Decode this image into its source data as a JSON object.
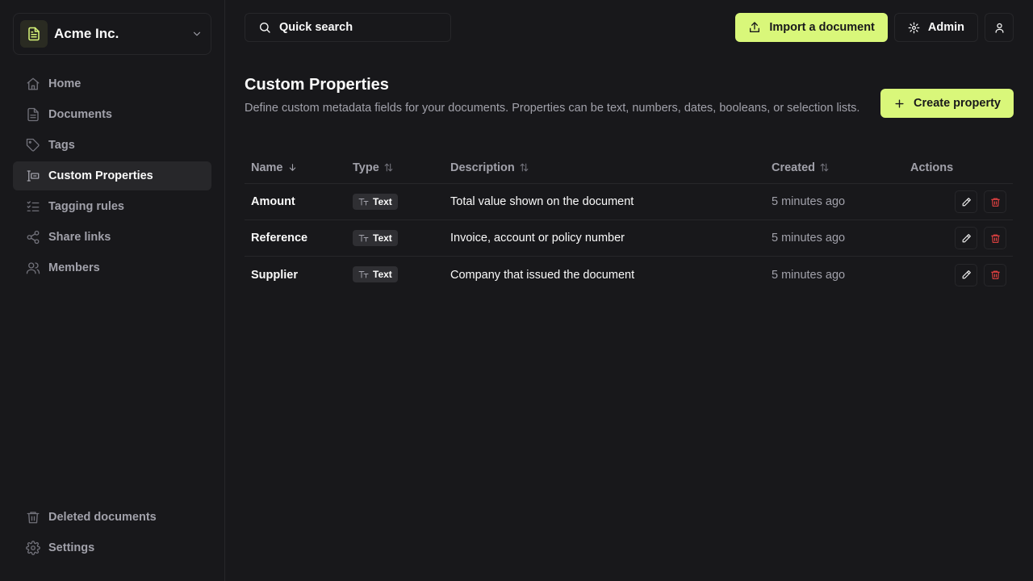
{
  "org": {
    "name": "Acme Inc.",
    "logo_icon": "document-icon",
    "accent": "#d9f77a"
  },
  "nav": {
    "items": [
      {
        "label": "Home",
        "icon": "home-icon"
      },
      {
        "label": "Documents",
        "icon": "file-icon"
      },
      {
        "label": "Tags",
        "icon": "tag-icon"
      },
      {
        "label": "Custom Properties",
        "icon": "properties-icon",
        "active": true
      },
      {
        "label": "Tagging rules",
        "icon": "list-check-icon"
      },
      {
        "label": "Share links",
        "icon": "share-icon"
      },
      {
        "label": "Members",
        "icon": "users-icon"
      }
    ],
    "bottom": [
      {
        "label": "Deleted documents",
        "icon": "trash-icon"
      },
      {
        "label": "Settings",
        "icon": "gear-icon"
      }
    ]
  },
  "topbar": {
    "search_label": "Quick search",
    "import_label": "Import a document",
    "admin_label": "Admin"
  },
  "page": {
    "title": "Custom Properties",
    "description": "Define custom metadata fields for your documents. Properties can be text, numbers, dates, booleans, or selection lists.",
    "create_label": "Create property"
  },
  "table": {
    "headers": {
      "name": "Name",
      "type": "Type",
      "description": "Description",
      "created": "Created",
      "actions": "Actions"
    },
    "rows": [
      {
        "name": "Amount",
        "type": "Text",
        "description": "Total value shown on the document",
        "created": "5 minutes ago"
      },
      {
        "name": "Reference",
        "type": "Text",
        "description": "Invoice, account or policy number",
        "created": "5 minutes ago"
      },
      {
        "name": "Supplier",
        "type": "Text",
        "description": "Company that issued the document",
        "created": "5 minutes ago"
      }
    ]
  },
  "colors": {
    "accent": "#d9f77a",
    "danger": "#ef4444",
    "background": "#18181b",
    "border": "#27272a"
  }
}
